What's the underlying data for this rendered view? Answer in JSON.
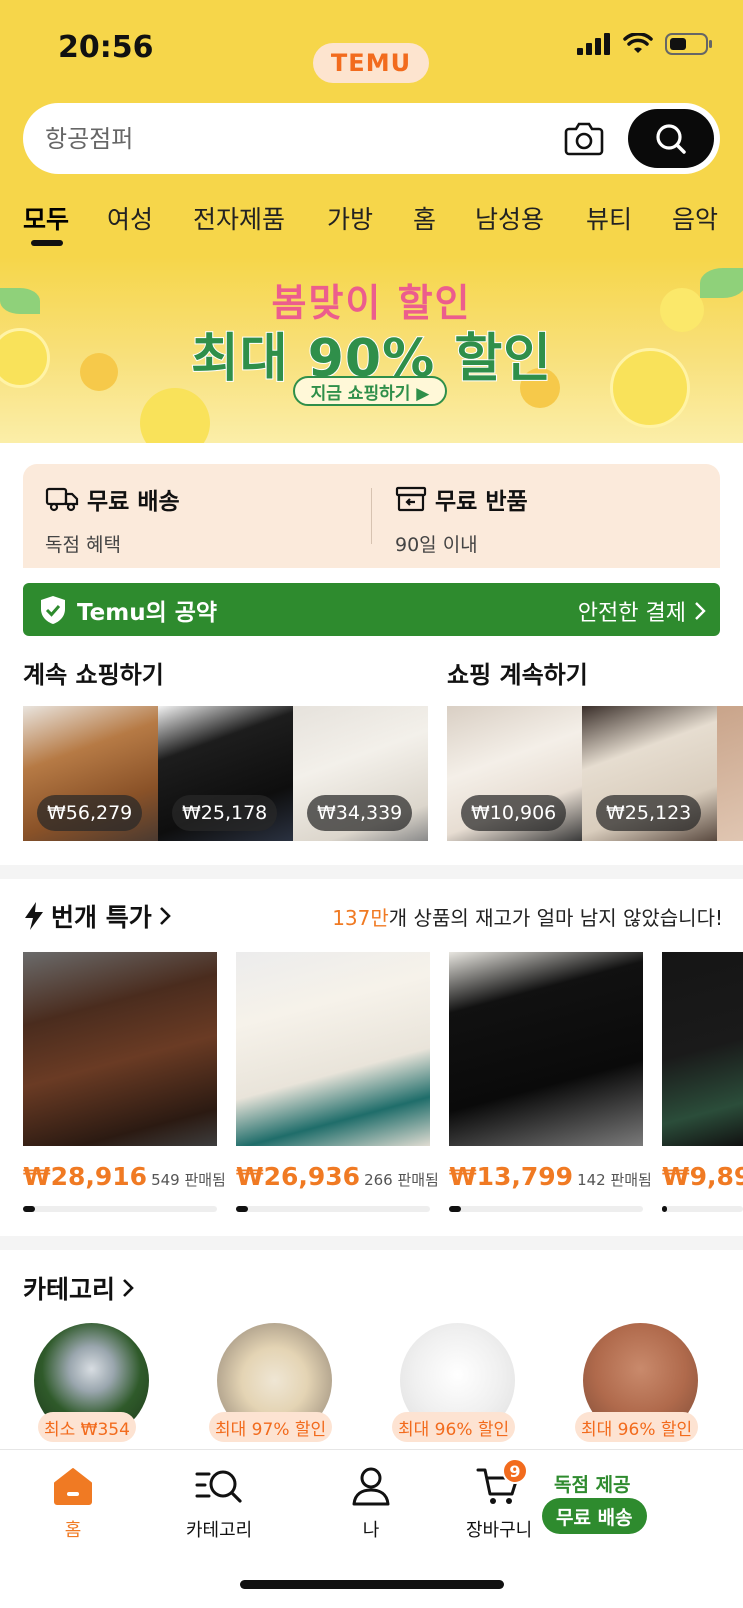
{
  "status_bar": {
    "time": "20:56",
    "logo": "TEMU"
  },
  "search": {
    "placeholder": "항공점퍼"
  },
  "tabs": [
    {
      "label": "모두"
    },
    {
      "label": "여성"
    },
    {
      "label": "전자제품"
    },
    {
      "label": "가방"
    },
    {
      "label": "홈"
    },
    {
      "label": "남성용"
    },
    {
      "label": "뷰티"
    },
    {
      "label": "음악"
    }
  ],
  "banner": {
    "line1": "봄맞이 할인",
    "line2": "최대 90% 할인",
    "cta": "지금 쇼핑하기 ▶"
  },
  "benefits": [
    {
      "title": "무료 배송",
      "sub": "독점 혜택"
    },
    {
      "title": "무료 반품",
      "sub": "90일 이내"
    }
  ],
  "pledge": {
    "left": "Temu의 공약",
    "right": "안전한 결제"
  },
  "continue_shopping": {
    "title": "계속 쇼핑하기",
    "prices": [
      "₩56,279",
      "₩25,178",
      "₩34,339"
    ]
  },
  "resume_shopping": {
    "title": "쇼핑 계속하기",
    "prices": [
      "₩10,906",
      "₩25,123"
    ]
  },
  "flash_deals": {
    "title": "번개 특가",
    "note_num": "137만",
    "note_text": "개 상품의 재고가 얼마 남지 않았습니다!",
    "items": [
      {
        "price": "₩28,916",
        "sold": "549 판매됨",
        "progress": 0.06
      },
      {
        "price": "₩26,936",
        "sold": "266 판매됨",
        "progress": 0.06
      },
      {
        "price": "₩13,799",
        "sold": "142 판매됨",
        "progress": 0.06
      },
      {
        "price": "₩9,89",
        "sold": "",
        "progress": 0.06
      }
    ]
  },
  "categories": {
    "title": "카테고리",
    "badges": [
      "최소 ₩354",
      "최대 97% 할인",
      "최대 96% 할인",
      "최대 96% 할인"
    ]
  },
  "bottom_nav": {
    "home": "홈",
    "category": "카테고리",
    "me": "나",
    "cart": "장바구니",
    "cart_count": "9",
    "promo_top": "독점 제공",
    "promo_pill": "무료 배송"
  },
  "colors": {
    "accent": "#f07a23",
    "brand_yellow": "#f6d64a",
    "green": "#2e8b2e"
  }
}
